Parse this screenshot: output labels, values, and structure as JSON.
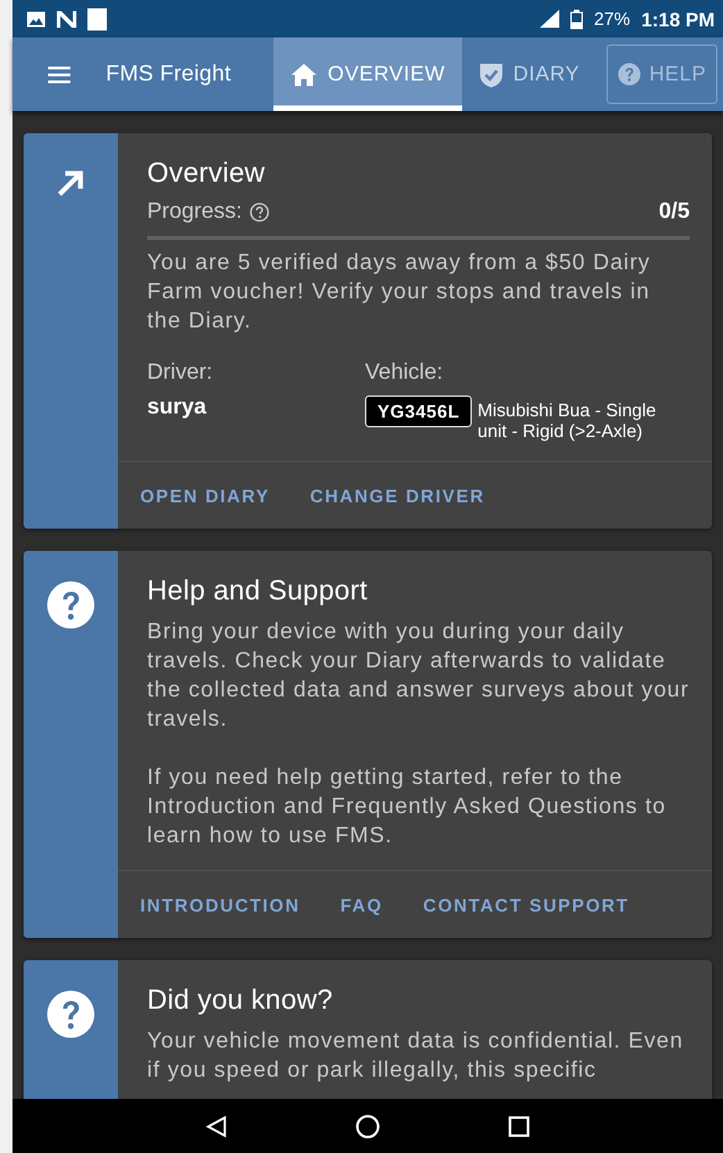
{
  "status_bar": {
    "battery": "27%",
    "time": "1:18 PM"
  },
  "app_bar": {
    "title": "FMS Freight",
    "tabs": [
      {
        "label": "OVERVIEW",
        "selected": true
      },
      {
        "label": "DIARY",
        "selected": false
      }
    ],
    "help_button": {
      "label": "HELP",
      "disabled": true
    }
  },
  "cards": [
    {
      "kind": "overview",
      "title": "Overview",
      "progress": {
        "label": "Progress:",
        "reading": "0/5",
        "level": 0
      },
      "paragraphs": [
        "You are 5 verified days away from a $50 Dairy Farm voucher! Verify your stops and travels in the Diary."
      ],
      "driver": {
        "label": "Driver:",
        "value": "surya"
      },
      "vehicle": {
        "label": "Vehicle:",
        "plate": "YG3456L",
        "description": "Misubishi Bua - Single unit - Rigid (>2-Axle)"
      },
      "actions": [
        "OPEN DIARY",
        "CHANGE DRIVER"
      ]
    },
    {
      "kind": "help",
      "title": "Help and Support",
      "paragraphs": [
        "Bring your device with you during your daily travels. Check your Diary afterwards to validate the collected data and answer surveys about your travels.",
        "If you need help getting started, refer to the Introduction and Frequently Asked Questions to learn how to use FMS."
      ],
      "actions": [
        "INTRODUCTION",
        "FAQ",
        "CONTACT SUPPORT"
      ]
    },
    {
      "kind": "help",
      "title": "Did you know?",
      "paragraphs": [
        "Your vehicle movement data is confidential. Even if you speed or park illegally, this specific"
      ]
    }
  ]
}
